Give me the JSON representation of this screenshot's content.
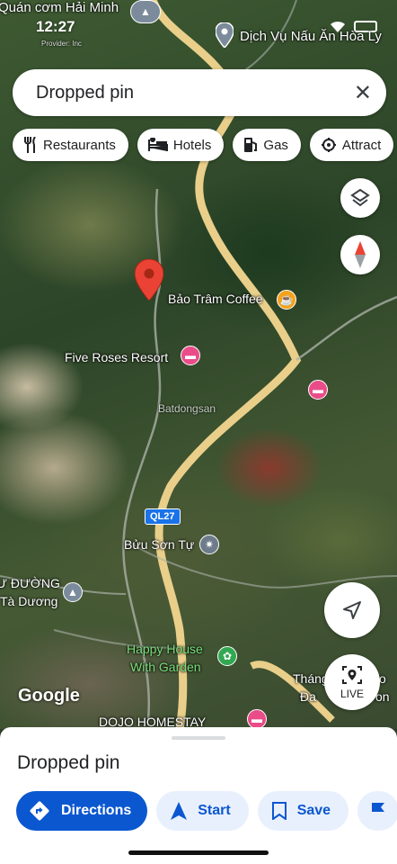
{
  "status_bar": {
    "time": "12:27"
  },
  "search": {
    "query": "Dropped pin"
  },
  "chips": [
    {
      "label": "Restaurants",
      "icon": "fork-knife-icon"
    },
    {
      "label": "Hotels",
      "icon": "bed-icon"
    },
    {
      "label": "Gas",
      "icon": "gas-pump-icon"
    },
    {
      "label": "Attract",
      "icon": "attraction-icon"
    }
  ],
  "map_labels": {
    "top_left_place": "Quán cơm Hải Minh",
    "top_right_place": "Dịch Vụ Nấu Ăn Hòa Ly",
    "cafe": "Bảo Trâm Coffee",
    "resort": "Five Roses Resort",
    "road": "QL27",
    "temple": "Bửu Sơn Tự",
    "left_place_1": "Ư ĐƯỜNG",
    "left_place_2": "Tà Dương",
    "park_1": "Happy House",
    "park_2": "With Garden",
    "right_place_1": "Tháng",
    "right_place_2": "Đa",
    "right_place_3": "o",
    "right_place_4": "on",
    "homestay": "DOJO HOMESTAY",
    "watermark": "Batdongsan",
    "provider": "Provider: Inc"
  },
  "live_label": "LIVE",
  "google_logo": "Google",
  "sheet": {
    "title": "Dropped pin",
    "actions": [
      {
        "label": "Directions",
        "icon": "directions-icon"
      },
      {
        "label": "Start",
        "icon": "navigation-arrow-icon"
      },
      {
        "label": "Save",
        "icon": "bookmark-icon"
      },
      {
        "label": "",
        "icon": "flag-icon"
      }
    ]
  },
  "colors": {
    "accent_blue": "#0b57d0",
    "pin_red": "#ea4335",
    "road_yellow": "#f2d68a"
  }
}
